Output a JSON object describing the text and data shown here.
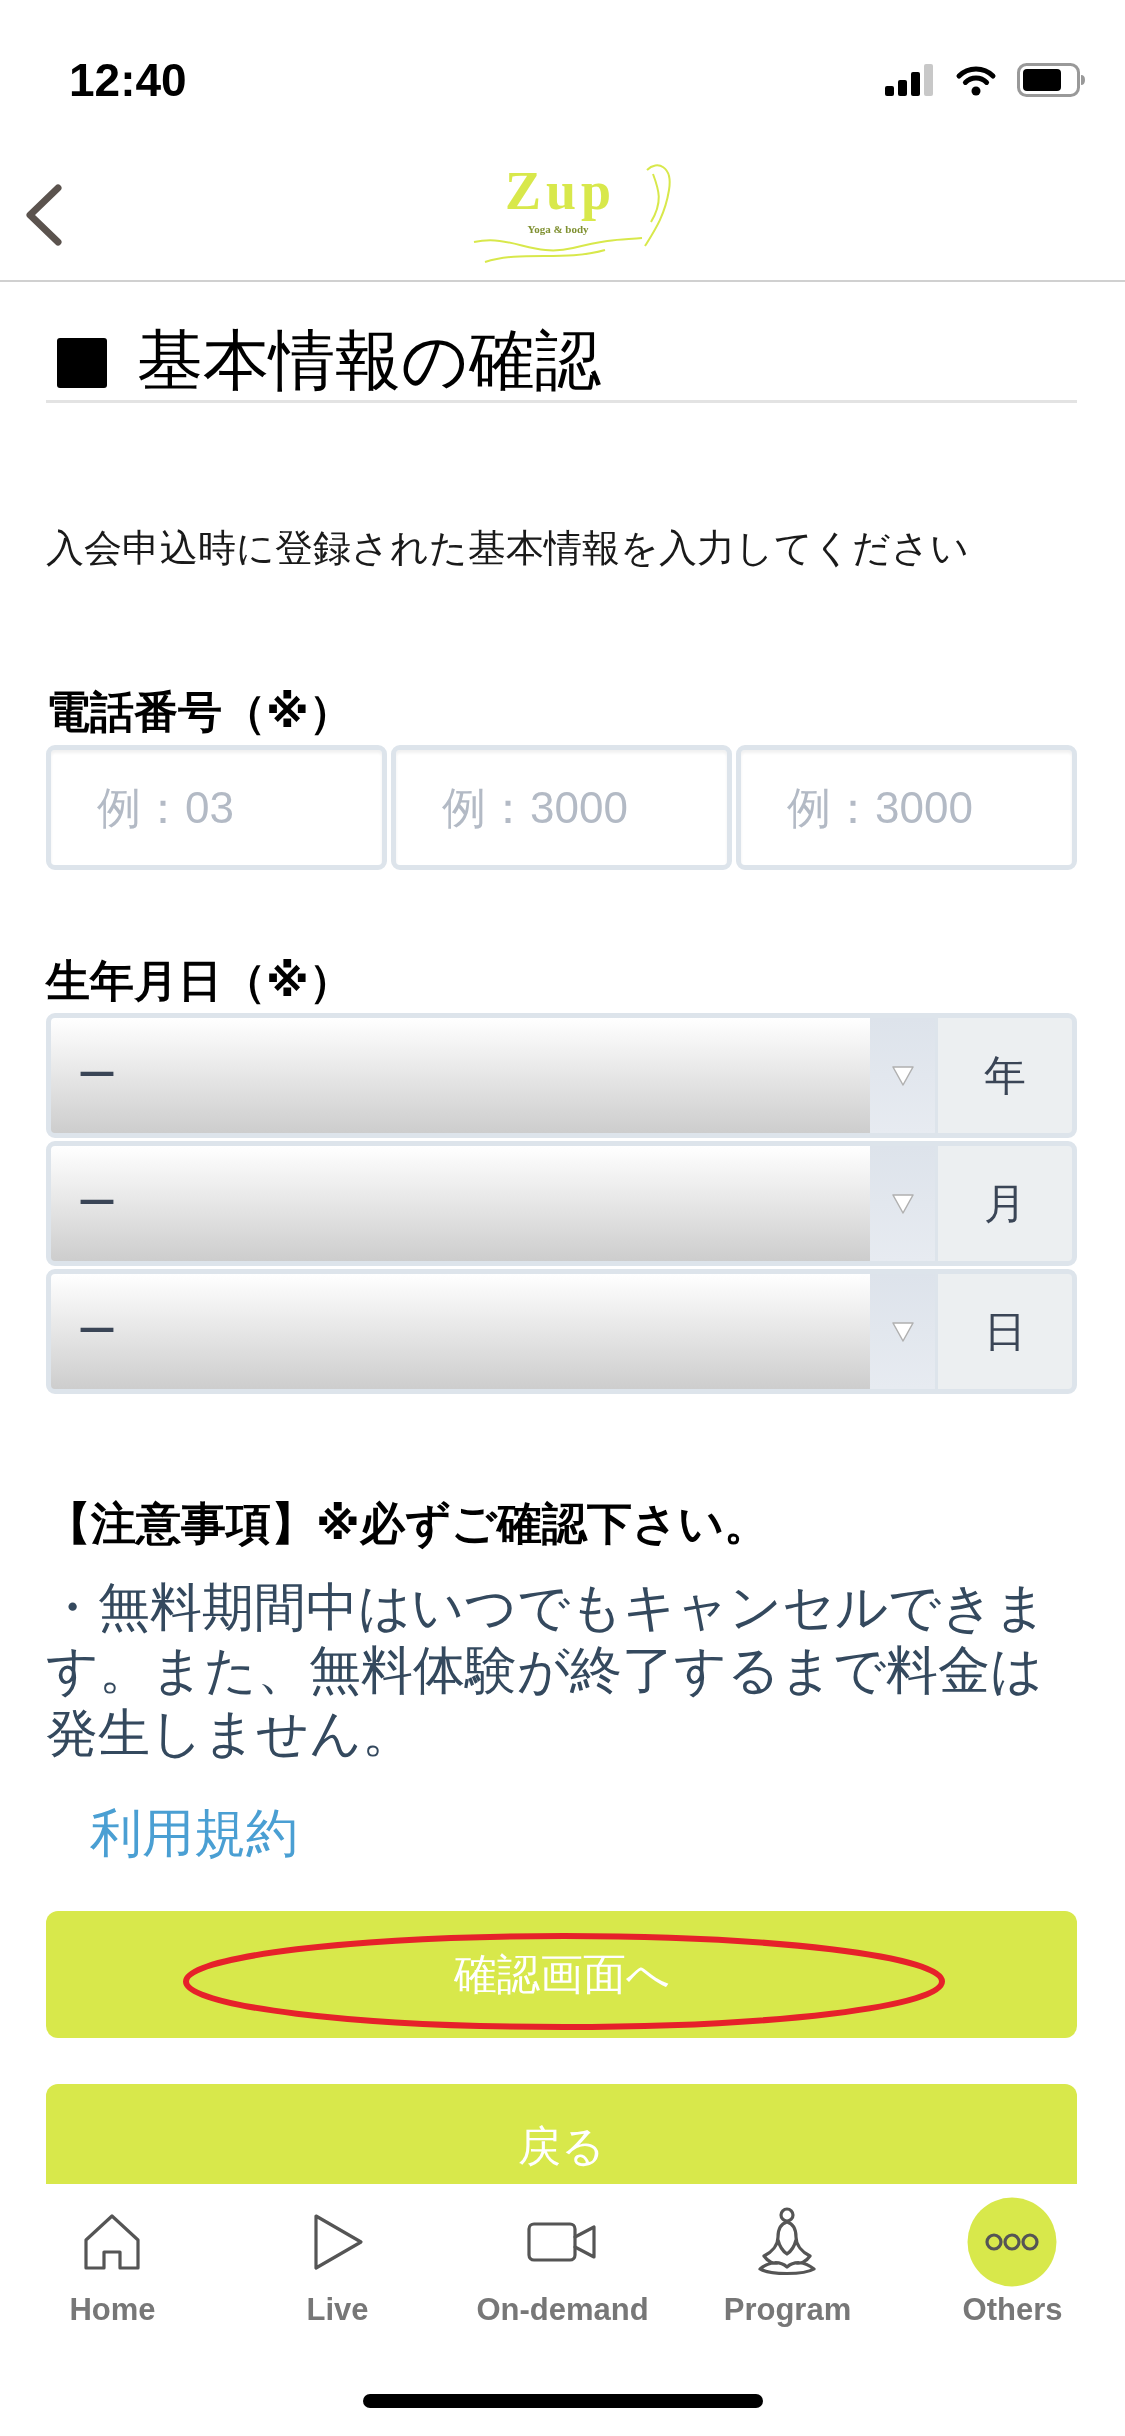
{
  "status_bar": {
    "time": "12:40"
  },
  "header": {
    "logo": {
      "wordmark": "Zup",
      "tagline": "Yoga & body"
    }
  },
  "page": {
    "title": "基本情報の確認",
    "description": "入会申込時に登録された基本情報を入力してください"
  },
  "phone": {
    "label": "電話番号（※）",
    "fields": [
      {
        "placeholder": "例：03"
      },
      {
        "placeholder": "例：3000"
      },
      {
        "placeholder": "例：3000"
      }
    ]
  },
  "birthdate": {
    "label": "生年月日（※）",
    "selects": [
      {
        "value": "ー",
        "unit": "年"
      },
      {
        "value": "ー",
        "unit": "月"
      },
      {
        "value": "ー",
        "unit": "日"
      }
    ]
  },
  "notice": {
    "heading": "【注意事項】※必ずご確認下さい。",
    "body": "・無料期間中はいつでもキャンセルできます。また、無料体験が終了するまで料金は発生しません。"
  },
  "terms_link": "利用規約",
  "buttons": [
    {
      "label": "確認画面へ",
      "highlighted": true
    },
    {
      "label": "戻る",
      "highlighted": false
    }
  ],
  "tab_bar": [
    {
      "kind": "home",
      "label": "Home",
      "selected": false
    },
    {
      "kind": "play",
      "label": "Live",
      "selected": false
    },
    {
      "kind": "camera",
      "label": "On-demand",
      "selected": false
    },
    {
      "kind": "meditation",
      "label": "Program",
      "selected": false
    },
    {
      "kind": "more",
      "label": "Others",
      "selected": true
    }
  ]
}
